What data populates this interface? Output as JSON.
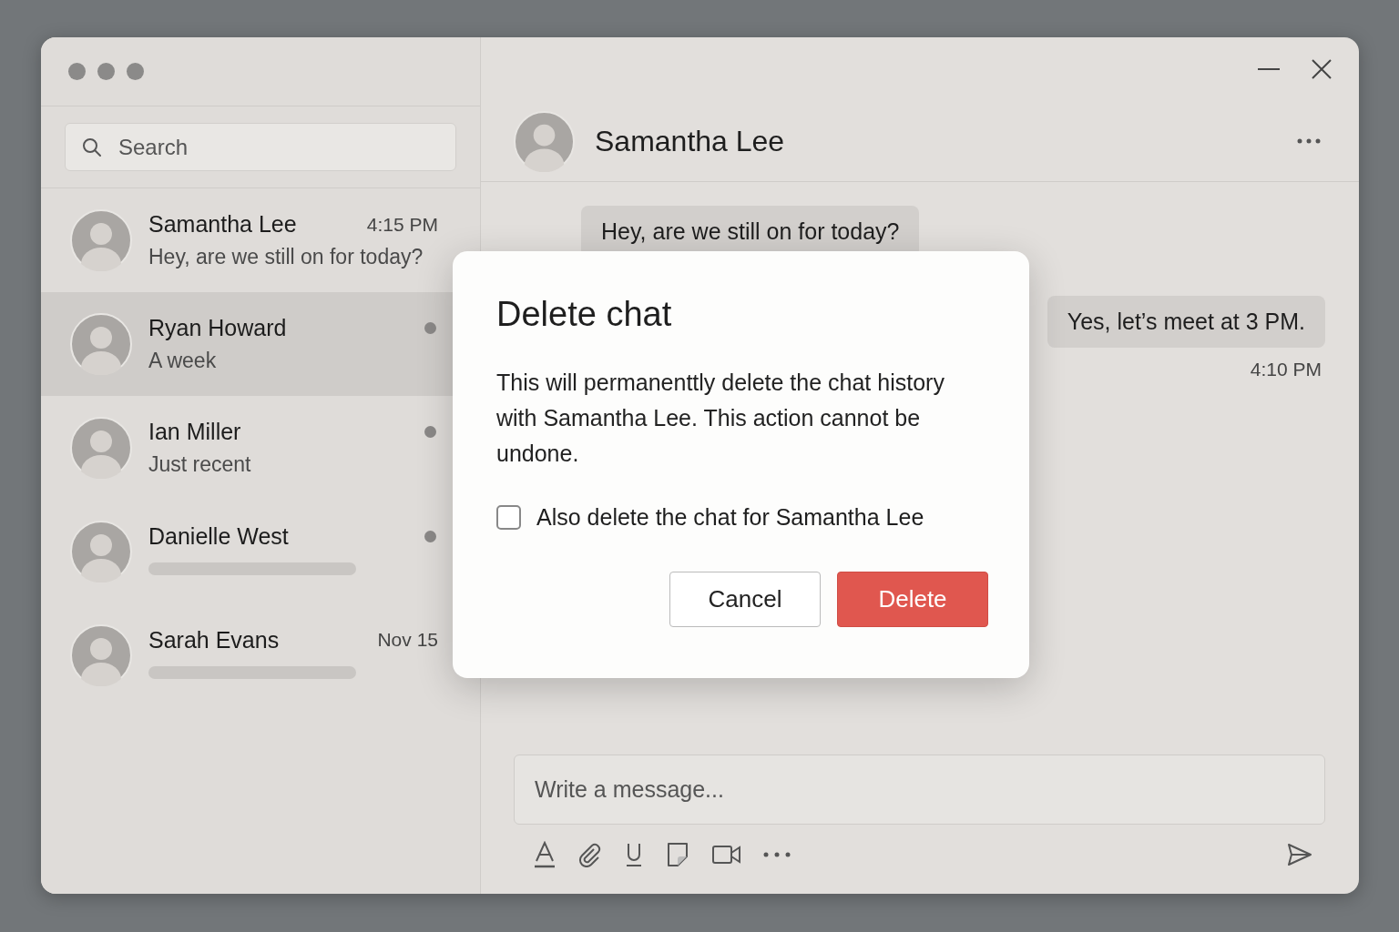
{
  "search": {
    "placeholder": "Search"
  },
  "chats": [
    {
      "name": "Samantha Lee",
      "preview": "Hey, are we still on for today?",
      "time": "4:15 PM",
      "unread": false,
      "selected": false
    },
    {
      "name": "Ryan Howard",
      "preview": "A week",
      "unread": true,
      "selected": true
    },
    {
      "name": "Ian Miller",
      "preview": "Just recent",
      "unread": true,
      "selected": false
    },
    {
      "name": "Danielle West",
      "unread": true,
      "selected": false
    },
    {
      "name": "Sarah Evans",
      "time": "Nov 15",
      "unread": false,
      "selected": false
    }
  ],
  "conversation": {
    "name": "Samantha Lee",
    "messages": [
      {
        "outgoing": false,
        "text": "Hey, are we still on for today?"
      },
      {
        "outgoing": true,
        "text": "Yes, let’s meet at 3 PM.",
        "time": "4:10 PM"
      }
    ],
    "composer": {
      "placeholder": "Write a message..."
    }
  },
  "dialog": {
    "title": "Delete chat",
    "body": "This will permanenttly delete the chat history with Samantha Lee. This action cannot be undone.",
    "checkbox": {
      "label": "Also delete the chat for Samantha Lee",
      "checked": false
    },
    "buttons": [
      {
        "label": "Cancel",
        "kind": "secondary"
      },
      {
        "label": "Delete",
        "kind": "danger"
      }
    ]
  }
}
